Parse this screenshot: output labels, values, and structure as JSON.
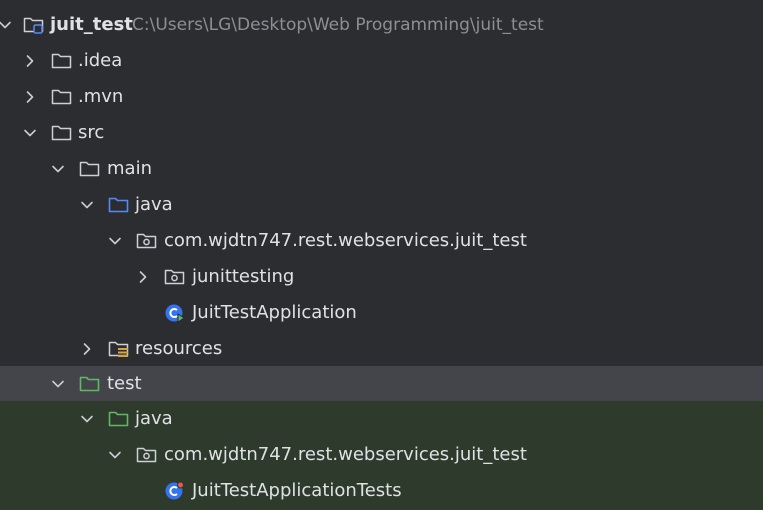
{
  "project_tree": {
    "root": {
      "label": "juit_test",
      "path": "C:\\Users\\LG\\Desktop\\Web Programming\\juit_test",
      "expanded": true,
      "icon": "module-folder-icon"
    },
    "nodes": [
      {
        "label": ".idea",
        "expanded": false,
        "icon": "folder-icon"
      },
      {
        "label": ".mvn",
        "expanded": false,
        "icon": "folder-icon"
      },
      {
        "label": "src",
        "expanded": true,
        "icon": "folder-icon"
      },
      {
        "label": "main",
        "expanded": true,
        "icon": "folder-icon"
      },
      {
        "label": "java",
        "expanded": true,
        "icon": "source-root-folder-icon"
      },
      {
        "label": "com.wjdtn747.rest.webservices.juit_test",
        "expanded": true,
        "icon": "package-icon"
      },
      {
        "label": "junittesting",
        "expanded": false,
        "icon": "package-icon"
      },
      {
        "label": "JuitTestApplication",
        "icon": "spring-boot-class-icon"
      },
      {
        "label": "resources",
        "expanded": false,
        "icon": "resources-folder-icon"
      },
      {
        "label": "test",
        "expanded": true,
        "icon": "test-folder-icon",
        "selected": true
      },
      {
        "label": "java",
        "expanded": true,
        "icon": "test-source-root-folder-icon"
      },
      {
        "label": "com.wjdtn747.rest.webservices.juit_test",
        "expanded": true,
        "icon": "package-icon"
      },
      {
        "label": "JuitTestApplicationTests",
        "icon": "test-class-icon"
      }
    ]
  },
  "colors": {
    "background": "#2b2d30",
    "selected_row": "#43454a",
    "test_scope_row": "#2e3a2c",
    "text": "#dfe1e5",
    "path_text": "#8c8f94",
    "source_root_blue": "#548af7",
    "test_root_green": "#5fb865",
    "class_blue": "#3574f0"
  }
}
